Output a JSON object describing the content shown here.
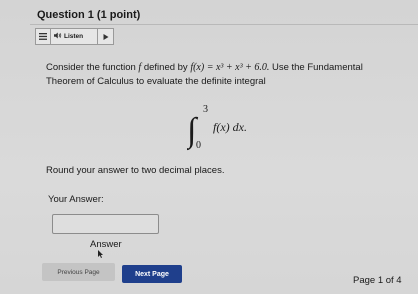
{
  "question": {
    "label": "Question 1",
    "points": "(1 point)"
  },
  "listen_bar": {
    "menu_icon": "hamburger-menu-icon",
    "speaker_icon": "speaker-icon",
    "label": "Listen",
    "play_icon": "play-icon"
  },
  "body": {
    "intro": "Consider the function",
    "f_name": "f",
    "defined_by": "defined by",
    "function_expr": "f(x) = x³ + x³ + 6.0.",
    "instruction_1": "Use the Fundamental",
    "instruction_2": "Theorem of Calculus to evaluate the definite integral",
    "integral_upper": "3",
    "integral_lower": "0",
    "integrand": "f(x) dx.",
    "rounding": "Round your answer to two decimal places."
  },
  "answer": {
    "prompt": "Your Answer:",
    "value": "",
    "label": "Answer"
  },
  "nav": {
    "previous_label": "Previous Page",
    "next_label": "Next Page",
    "page_indicator": "Page 1 of 4"
  },
  "colors": {
    "next_button": "#1f3f8c",
    "previous_button": "#c4c4c4",
    "background": "#d8d8d8"
  }
}
